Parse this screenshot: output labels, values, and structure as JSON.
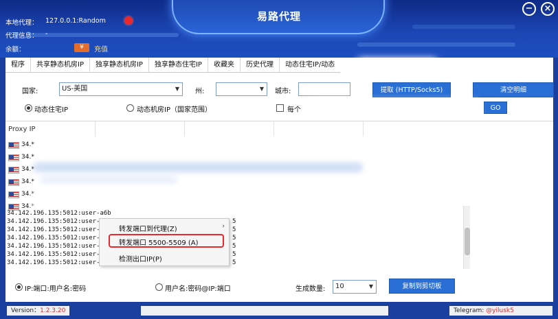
{
  "window": {
    "title": "易路代理",
    "minimize_icon": "minus-circle-icon",
    "close_icon": "x-circle-icon"
  },
  "info": {
    "local_proxy_label": "本地代理：",
    "local_proxy_value": "127.0.0.1:Random",
    "proxy_info_label": "代理信息：",
    "proxy_info_value": "-",
    "balance_label": "余额：",
    "yen_symbol": "¥",
    "recharge_label": "充值"
  },
  "tabs": [
    "程序",
    "共享静态机房IP",
    "独享静态机房IP",
    "独享静态住宅IP",
    "收藏夹",
    "历史代理",
    "动态住宅IP/动态"
  ],
  "filters": {
    "country_label": "国家:",
    "country_value": "US-美国",
    "state_label": "州:",
    "state_value": "",
    "city_label": "城市:",
    "city_value": "",
    "extract_button": "提取 (HTTP/Socks5)",
    "clear_button": "清空明细",
    "go_button": "GO",
    "radio_dynamic_residential": "动态住宅IP",
    "radio_dynamic_datacenter": "动态机房IP（国家范围）",
    "checkbox_label": "每个"
  },
  "list": {
    "header": "Proxy IP",
    "rows": [
      "34.*",
      "34.*",
      "34.*",
      "34.*",
      "34.*",
      "34.*"
    ]
  },
  "output_lines": [
    "34.142.196.135:5012:user-a6b",
    "34.142.196.135:5012:user-a6b",
    "34.142.196.135:5012:user-a6b",
    "34.142.196.135:5012:user-a6b",
    "34.142.196.135:5012:user-a6b",
    "34.142.196.135:5012:user-a6b",
    "34.142.196.135:5012:user-a6b"
  ],
  "output_suffix": [
    "5",
    "5",
    "5",
    "5",
    "5",
    "5"
  ],
  "context_menu": {
    "items": [
      {
        "label": "转发端口到代理(Z)",
        "has_submenu": true
      },
      {
        "label": "转发端口 5500-5509 (A)",
        "highlighted": true
      },
      {
        "label": "检测出口IP(P)"
      }
    ]
  },
  "format_options": {
    "option1": "IP:端口:用户名:密码",
    "option2": "用户名:密码@IP:端口",
    "count_label": "生成数量:",
    "count_value": "10",
    "copy_button": "复制到剪切板"
  },
  "status": {
    "version_label": "Version：",
    "version_value": "1.2.3.20",
    "telegram_label": "Telegram:",
    "telegram_value": "@yilusk5"
  },
  "colors": {
    "header_bg": "#1b46b3",
    "accent_blue": "#2a6fd6",
    "highlight_red": "#e8282a",
    "recharge_yellow": "#ffde66"
  }
}
